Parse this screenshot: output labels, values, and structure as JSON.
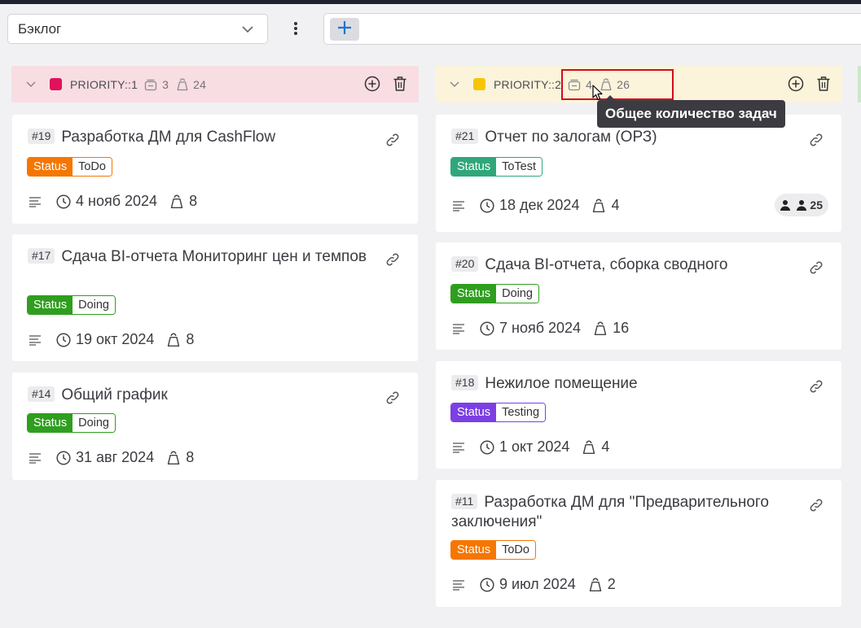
{
  "toolbar": {
    "board_select": "Бэклог",
    "menu_icon": "kebab-icon",
    "add_icon": "plus-icon"
  },
  "columns": [
    {
      "label": "PRIORITY::1",
      "color": "#e0125b",
      "header_bg": "#f8dde3",
      "issue_count": "3",
      "weight_total": "24",
      "cards": [
        {
          "iid": "#19",
          "title": "Разработка ДМ для CashFlow",
          "status_key": "Status",
          "status_value": "ToDo",
          "status_color": "#f57600",
          "date": "4 нояб 2024",
          "weight": "8"
        },
        {
          "iid": "#17",
          "title": "Сдача BI-отчета Мониторинг цен и темпов",
          "status_key": "Status",
          "status_value": "Doing",
          "status_color": "#2f9e1f",
          "date": "19 окт 2024",
          "weight": "8"
        },
        {
          "iid": "#14",
          "title": "Общий график",
          "status_key": "Status",
          "status_value": "Doing",
          "status_color": "#2f9e1f",
          "date": "31 авг 2024",
          "weight": "8"
        }
      ]
    },
    {
      "label": "PRIORITY::2",
      "color": "#f5c600",
      "header_bg": "#fbf4db",
      "issue_count": "4",
      "weight_total": "26",
      "cards": [
        {
          "iid": "#21",
          "title": "Отчет по залогам (ОРЗ)",
          "status_key": "Status",
          "status_value": "ToTest",
          "status_color": "#2fa77a",
          "date": "18 дек 2024",
          "weight": "4",
          "assignees_count": "25"
        },
        {
          "iid": "#20",
          "title": "Сдача BI-отчета, сборка сводного",
          "status_key": "Status",
          "status_value": "Doing",
          "status_color": "#2f9e1f",
          "date": "7 нояб 2024",
          "weight": "16"
        },
        {
          "iid": "#18",
          "title": "Нежилое помещение",
          "status_key": "Status",
          "status_value": "Testing",
          "status_color": "#7b3fe4",
          "date": "1 окт 2024",
          "weight": "4"
        },
        {
          "iid": "#11",
          "title": "Разработка ДМ для \"Предварительного заключения\"",
          "status_key": "Status",
          "status_value": "ToDo",
          "status_color": "#f57600",
          "date": "9 июл 2024",
          "weight": "2"
        }
      ]
    }
  ],
  "tooltip": {
    "text": "Общее количество задач"
  }
}
